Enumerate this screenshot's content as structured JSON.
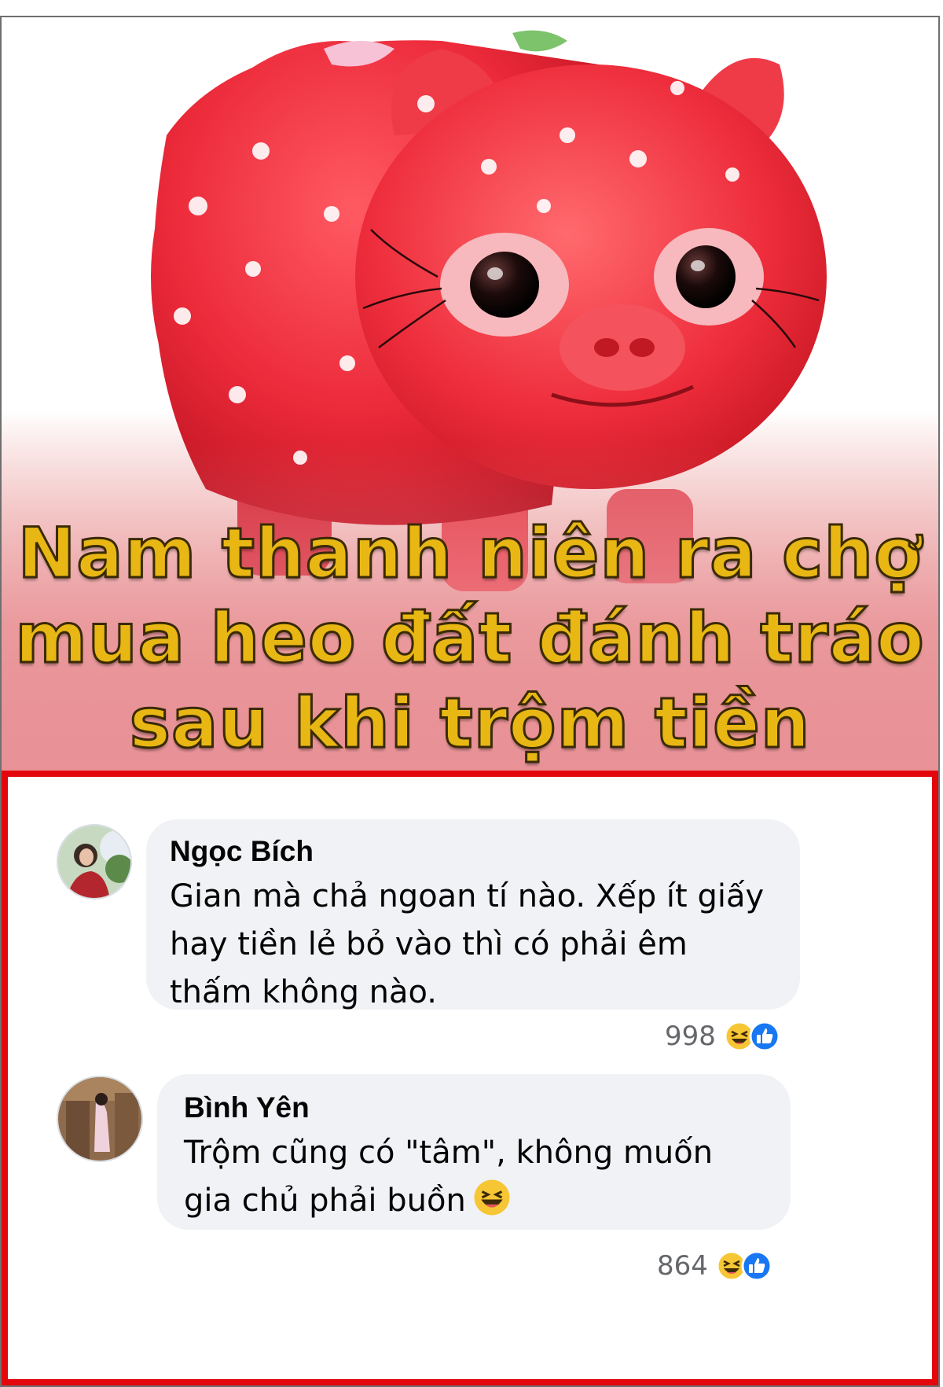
{
  "headline": "Nam thanh niên ra chợ\nmua heo đất đánh tráo\nsau khi trộm tiền",
  "colors": {
    "headline_fill": "#e8b714",
    "panel_border": "#e3070d",
    "bubble_bg": "#f0f2f5",
    "pig_red": "#e8283a",
    "like_blue": "#1877f2",
    "haha_yellow": "#f7c634"
  },
  "comments": [
    {
      "author": "Ngọc Bích",
      "text": "Gian mà chả ngoan tí nào. Xếp ít giấy hay tiền lẻ bỏ vào thì có phải êm thấm không nào.",
      "reaction_count": "998",
      "reaction_icons": [
        "haha-icon",
        "like-icon"
      ]
    },
    {
      "author": "Bình Yên",
      "text": "Trộm cũng có \"tâm\", không muốn gia chủ phải buồn",
      "inline_emoji": "laughing-emoji-icon",
      "reaction_count": "864",
      "reaction_icons": [
        "haha-icon",
        "like-icon"
      ]
    }
  ]
}
